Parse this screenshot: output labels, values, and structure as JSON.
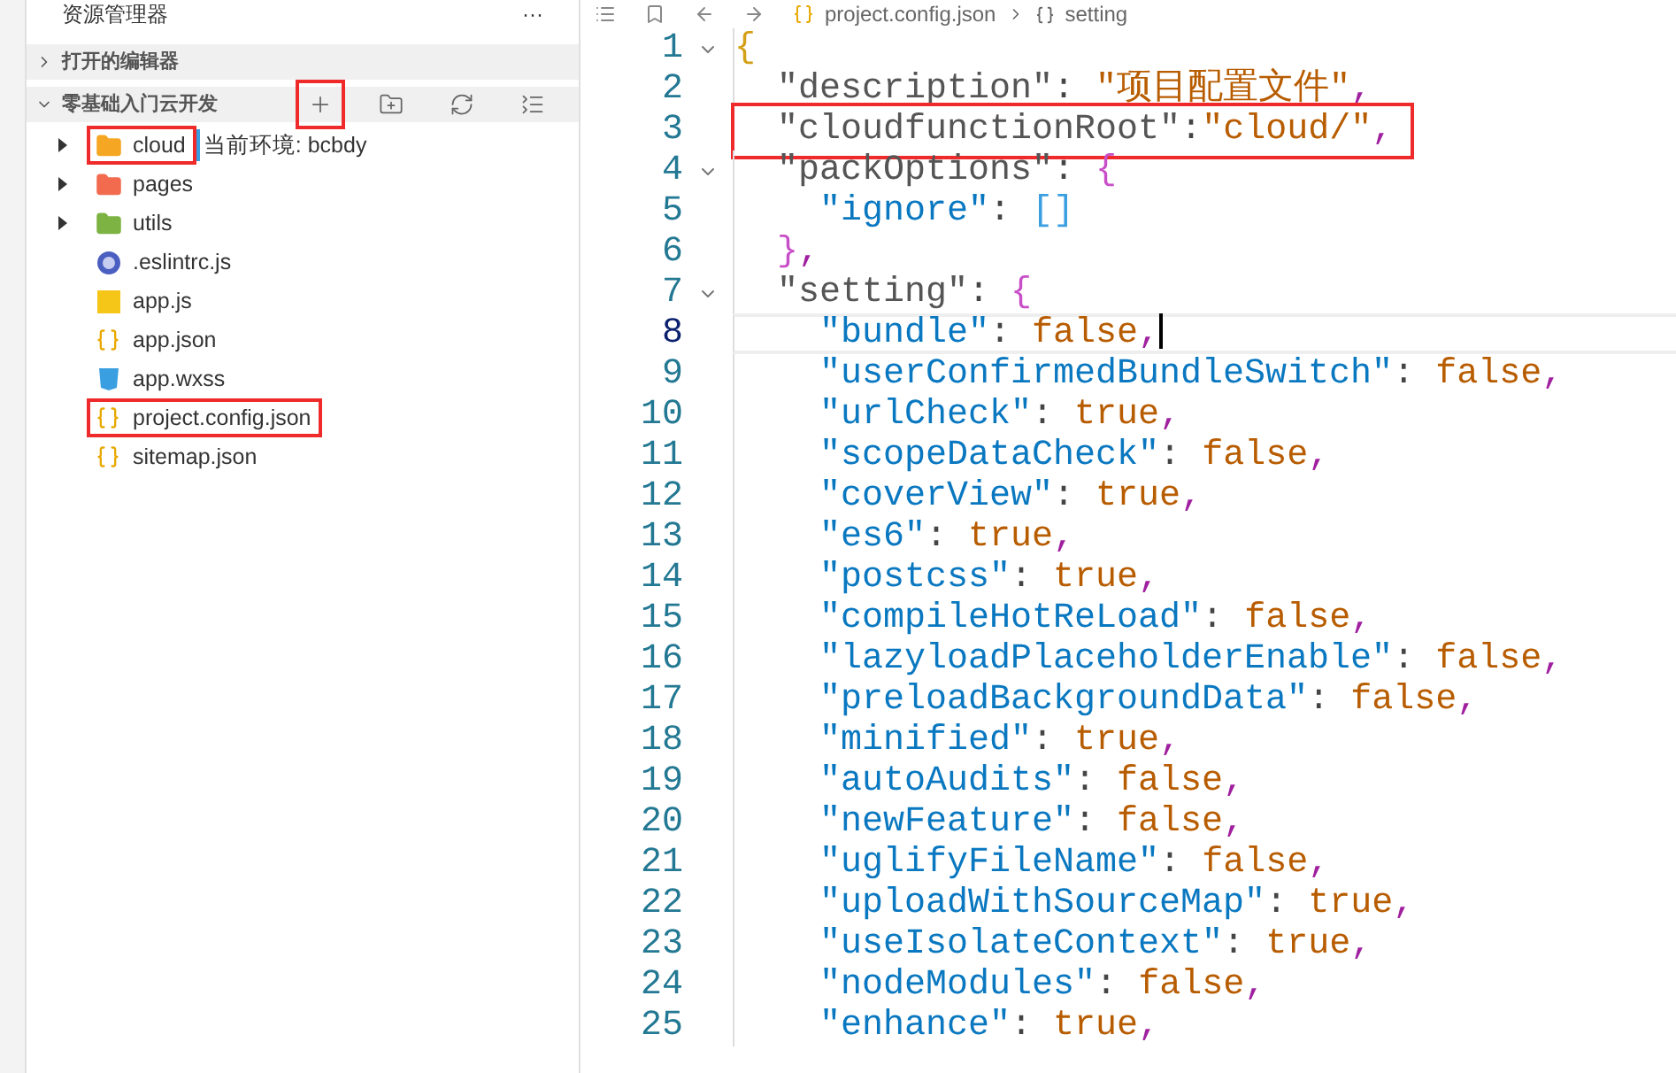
{
  "sidebar": {
    "title": "资源管理器",
    "more": "···",
    "sections": [
      {
        "label": "打开的编辑器",
        "expanded": false
      },
      {
        "label": "零基础入门云开发",
        "expanded": true
      }
    ],
    "toolbar": [
      {
        "kind": "new-file",
        "highlight": true
      },
      {
        "kind": "new-folder",
        "highlight": false
      },
      {
        "kind": "refresh",
        "highlight": false
      },
      {
        "kind": "collapse",
        "highlight": false
      }
    ],
    "items": [
      {
        "kind": "folder",
        "name": "cloud",
        "color": "#f5a623",
        "expanded": false,
        "highlight": true,
        "note": "当前环境: bcbdy"
      },
      {
        "kind": "folder",
        "name": "pages",
        "color": "#f26b4f",
        "expanded": false,
        "highlight": false
      },
      {
        "kind": "folder",
        "name": "utils",
        "color": "#7cb342",
        "expanded": false,
        "highlight": false
      },
      {
        "kind": "eslint",
        "name": ".eslintrc.js",
        "highlight": false
      },
      {
        "kind": "js",
        "name": "app.js",
        "highlight": false
      },
      {
        "kind": "json",
        "name": "app.json",
        "highlight": false
      },
      {
        "kind": "wxss",
        "name": "app.wxss",
        "highlight": false
      },
      {
        "kind": "json",
        "name": "project.config.json",
        "highlight": true
      },
      {
        "kind": "json",
        "name": "sitemap.json",
        "highlight": false
      }
    ]
  },
  "editor": {
    "breadcrumb": [
      "project.config.json",
      "setting"
    ],
    "lines": [
      {
        "number": "1",
        "fold": true,
        "current": false,
        "highlight": false,
        "tokens": [
          {
            "kind": "brace1",
            "text": "{"
          }
        ]
      },
      {
        "number": "2",
        "fold": false,
        "current": false,
        "highlight": false,
        "tokens": [
          {
            "kind": "key",
            "text": "  \"description\""
          },
          {
            "kind": "punct",
            "text": ": "
          },
          {
            "kind": "string",
            "text": "\"项目配置文件\""
          },
          {
            "kind": "comma",
            "text": ","
          }
        ]
      },
      {
        "number": "3",
        "fold": false,
        "current": false,
        "highlight": true,
        "tokens": [
          {
            "kind": "key",
            "text": "  \"cloudfunctionRoot\""
          },
          {
            "kind": "punct",
            "text": ":"
          },
          {
            "kind": "string",
            "text": "\"cloud/\""
          },
          {
            "kind": "comma",
            "text": ","
          }
        ]
      },
      {
        "number": "4",
        "fold": true,
        "current": false,
        "highlight": false,
        "tokens": [
          {
            "kind": "key",
            "text": "  \"packOptions\""
          },
          {
            "kind": "punct",
            "text": ": "
          },
          {
            "kind": "brace2",
            "text": "{"
          }
        ]
      },
      {
        "number": "5",
        "fold": false,
        "current": false,
        "highlight": false,
        "tokens": [
          {
            "kind": "key2",
            "text": "    \"ignore\""
          },
          {
            "kind": "punct",
            "text": ": "
          },
          {
            "kind": "brace3",
            "text": "[]"
          }
        ]
      },
      {
        "number": "6",
        "fold": false,
        "current": false,
        "highlight": false,
        "tokens": [
          {
            "kind": "brace2",
            "text": "  }"
          },
          {
            "kind": "comma",
            "text": ","
          }
        ]
      },
      {
        "number": "7",
        "fold": true,
        "current": false,
        "highlight": false,
        "tokens": [
          {
            "kind": "key",
            "text": "  \"setting\""
          },
          {
            "kind": "punct",
            "text": ": "
          },
          {
            "kind": "brace2",
            "text": "{"
          }
        ]
      },
      {
        "number": "8",
        "fold": false,
        "current": true,
        "highlight": false,
        "tokens": [
          {
            "kind": "key2",
            "text": "    \"bundle\""
          },
          {
            "kind": "punct",
            "text": ": "
          },
          {
            "kind": "bool",
            "text": "false"
          },
          {
            "kind": "comma",
            "text": ","
          }
        ]
      },
      {
        "number": "9",
        "fold": false,
        "current": false,
        "highlight": false,
        "tokens": [
          {
            "kind": "key2",
            "text": "    \"userConfirmedBundleSwitch\""
          },
          {
            "kind": "punct",
            "text": ": "
          },
          {
            "kind": "bool",
            "text": "false"
          },
          {
            "kind": "comma",
            "text": ","
          }
        ]
      },
      {
        "number": "10",
        "fold": false,
        "current": false,
        "highlight": false,
        "tokens": [
          {
            "kind": "key2",
            "text": "    \"urlCheck\""
          },
          {
            "kind": "punct",
            "text": ": "
          },
          {
            "kind": "bool",
            "text": "true"
          },
          {
            "kind": "comma",
            "text": ","
          }
        ]
      },
      {
        "number": "11",
        "fold": false,
        "current": false,
        "highlight": false,
        "tokens": [
          {
            "kind": "key2",
            "text": "    \"scopeDataCheck\""
          },
          {
            "kind": "punct",
            "text": ": "
          },
          {
            "kind": "bool",
            "text": "false"
          },
          {
            "kind": "comma",
            "text": ","
          }
        ]
      },
      {
        "number": "12",
        "fold": false,
        "current": false,
        "highlight": false,
        "tokens": [
          {
            "kind": "key2",
            "text": "    \"coverView\""
          },
          {
            "kind": "punct",
            "text": ": "
          },
          {
            "kind": "bool",
            "text": "true"
          },
          {
            "kind": "comma",
            "text": ","
          }
        ]
      },
      {
        "number": "13",
        "fold": false,
        "current": false,
        "highlight": false,
        "tokens": [
          {
            "kind": "key2",
            "text": "    \"es6\""
          },
          {
            "kind": "punct",
            "text": ": "
          },
          {
            "kind": "bool",
            "text": "true"
          },
          {
            "kind": "comma",
            "text": ","
          }
        ]
      },
      {
        "number": "14",
        "fold": false,
        "current": false,
        "highlight": false,
        "tokens": [
          {
            "kind": "key2",
            "text": "    \"postcss\""
          },
          {
            "kind": "punct",
            "text": ": "
          },
          {
            "kind": "bool",
            "text": "true"
          },
          {
            "kind": "comma",
            "text": ","
          }
        ]
      },
      {
        "number": "15",
        "fold": false,
        "current": false,
        "highlight": false,
        "tokens": [
          {
            "kind": "key2",
            "text": "    \"compileHotReLoad\""
          },
          {
            "kind": "punct",
            "text": ": "
          },
          {
            "kind": "bool",
            "text": "false"
          },
          {
            "kind": "comma",
            "text": ","
          }
        ]
      },
      {
        "number": "16",
        "fold": false,
        "current": false,
        "highlight": false,
        "tokens": [
          {
            "kind": "key2",
            "text": "    \"lazyloadPlaceholderEnable\""
          },
          {
            "kind": "punct",
            "text": ": "
          },
          {
            "kind": "bool",
            "text": "false"
          },
          {
            "kind": "comma",
            "text": ","
          }
        ]
      },
      {
        "number": "17",
        "fold": false,
        "current": false,
        "highlight": false,
        "tokens": [
          {
            "kind": "key2",
            "text": "    \"preloadBackgroundData\""
          },
          {
            "kind": "punct",
            "text": ": "
          },
          {
            "kind": "bool",
            "text": "false"
          },
          {
            "kind": "comma",
            "text": ","
          }
        ]
      },
      {
        "number": "18",
        "fold": false,
        "current": false,
        "highlight": false,
        "tokens": [
          {
            "kind": "key2",
            "text": "    \"minified\""
          },
          {
            "kind": "punct",
            "text": ": "
          },
          {
            "kind": "bool",
            "text": "true"
          },
          {
            "kind": "comma",
            "text": ","
          }
        ]
      },
      {
        "number": "19",
        "fold": false,
        "current": false,
        "highlight": false,
        "tokens": [
          {
            "kind": "key2",
            "text": "    \"autoAudits\""
          },
          {
            "kind": "punct",
            "text": ": "
          },
          {
            "kind": "bool",
            "text": "false"
          },
          {
            "kind": "comma",
            "text": ","
          }
        ]
      },
      {
        "number": "20",
        "fold": false,
        "current": false,
        "highlight": false,
        "tokens": [
          {
            "kind": "key2",
            "text": "    \"newFeature\""
          },
          {
            "kind": "punct",
            "text": ": "
          },
          {
            "kind": "bool",
            "text": "false"
          },
          {
            "kind": "comma",
            "text": ","
          }
        ]
      },
      {
        "number": "21",
        "fold": false,
        "current": false,
        "highlight": false,
        "tokens": [
          {
            "kind": "key2",
            "text": "    \"uglifyFileName\""
          },
          {
            "kind": "punct",
            "text": ": "
          },
          {
            "kind": "bool",
            "text": "false"
          },
          {
            "kind": "comma",
            "text": ","
          }
        ]
      },
      {
        "number": "22",
        "fold": false,
        "current": false,
        "highlight": false,
        "tokens": [
          {
            "kind": "key2",
            "text": "    \"uploadWithSourceMap\""
          },
          {
            "kind": "punct",
            "text": ": "
          },
          {
            "kind": "bool",
            "text": "true"
          },
          {
            "kind": "comma",
            "text": ","
          }
        ]
      },
      {
        "number": "23",
        "fold": false,
        "current": false,
        "highlight": false,
        "tokens": [
          {
            "kind": "key2",
            "text": "    \"useIsolateContext\""
          },
          {
            "kind": "punct",
            "text": ": "
          },
          {
            "kind": "bool",
            "text": "true"
          },
          {
            "kind": "comma",
            "text": ","
          }
        ]
      },
      {
        "number": "24",
        "fold": false,
        "current": false,
        "highlight": false,
        "tokens": [
          {
            "kind": "key2",
            "text": "    \"nodeModules\""
          },
          {
            "kind": "punct",
            "text": ": "
          },
          {
            "kind": "bool",
            "text": "false"
          },
          {
            "kind": "comma",
            "text": ","
          }
        ]
      },
      {
        "number": "25",
        "fold": false,
        "current": false,
        "highlight": false,
        "tokens": [
          {
            "kind": "key2",
            "text": "    \"enhance\""
          },
          {
            "kind": "punct",
            "text": ": "
          },
          {
            "kind": "bool",
            "text": "true"
          },
          {
            "kind": "comma",
            "text": ","
          }
        ]
      }
    ]
  }
}
